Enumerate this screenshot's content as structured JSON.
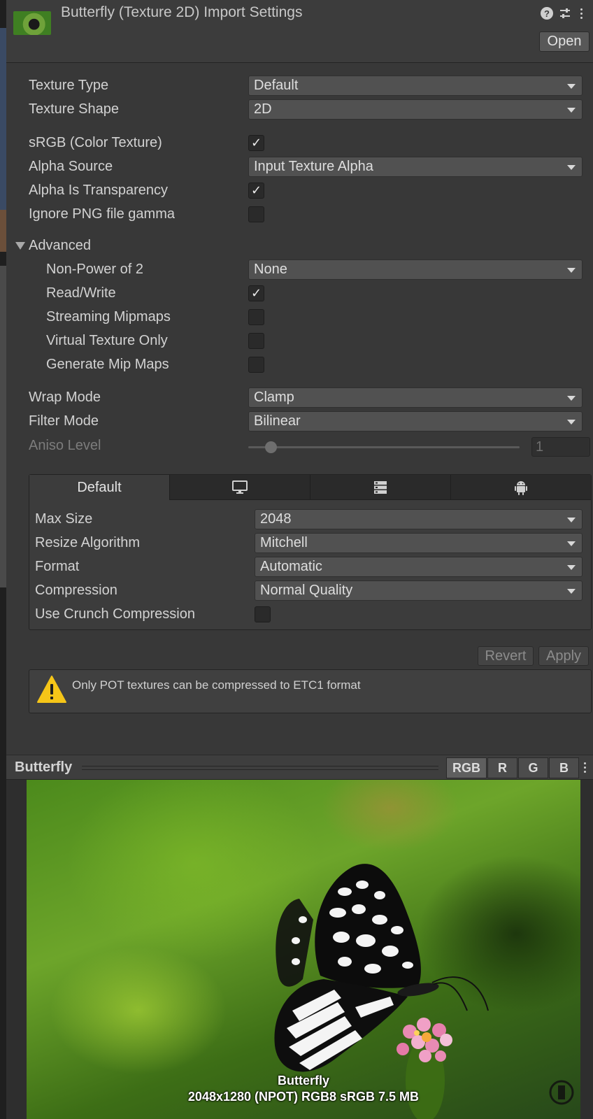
{
  "header": {
    "title": "Butterfly (Texture 2D) Import Settings",
    "help_icon": "help-icon",
    "presets_icon": "presets-icon",
    "open_label": "Open"
  },
  "settings": {
    "texture_type": {
      "label": "Texture Type",
      "value": "Default"
    },
    "texture_shape": {
      "label": "Texture Shape",
      "value": "2D"
    },
    "srgb": {
      "label": "sRGB (Color Texture)",
      "checked": true
    },
    "alpha_source": {
      "label": "Alpha Source",
      "value": "Input Texture Alpha"
    },
    "alpha_is_transparency": {
      "label": "Alpha Is Transparency",
      "checked": true
    },
    "ignore_png_gamma": {
      "label": "Ignore PNG file gamma",
      "checked": false
    }
  },
  "advanced": {
    "label": "Advanced",
    "expanded": true,
    "non_power_of_2": {
      "label": "Non-Power of 2",
      "value": "None"
    },
    "read_write": {
      "label": "Read/Write",
      "checked": true
    },
    "streaming_mipmaps": {
      "label": "Streaming Mipmaps",
      "checked": false
    },
    "virtual_texture_only": {
      "label": "Virtual Texture Only",
      "checked": false
    },
    "generate_mip_maps": {
      "label": "Generate Mip Maps",
      "checked": false
    }
  },
  "sampling": {
    "wrap_mode": {
      "label": "Wrap Mode",
      "value": "Clamp"
    },
    "filter_mode": {
      "label": "Filter Mode",
      "value": "Bilinear"
    },
    "aniso_level": {
      "label": "Aniso Level",
      "value": "1",
      "disabled": true
    }
  },
  "platform": {
    "tabs": [
      {
        "label": "Default",
        "icon": null,
        "active": true
      },
      {
        "label": "",
        "icon": "monitor-icon",
        "active": false
      },
      {
        "label": "",
        "icon": "server-icon",
        "active": false
      },
      {
        "label": "",
        "icon": "android-icon",
        "active": false
      }
    ],
    "max_size": {
      "label": "Max Size",
      "value": "2048"
    },
    "resize_algorithm": {
      "label": "Resize Algorithm",
      "value": "Mitchell"
    },
    "format": {
      "label": "Format",
      "value": "Automatic"
    },
    "compression": {
      "label": "Compression",
      "value": "Normal Quality"
    },
    "use_crunch": {
      "label": "Use Crunch Compression",
      "checked": false
    }
  },
  "actions": {
    "revert_label": "Revert",
    "apply_label": "Apply"
  },
  "warning": {
    "icon": "warning-icon",
    "text": "Only POT textures can be compressed to ETC1 format"
  },
  "preview": {
    "title": "Butterfly",
    "channels": [
      "RGB",
      "R",
      "G",
      "B"
    ],
    "active_channel": "RGB",
    "caption_name": "Butterfly",
    "caption_info": "2048x1280 (NPOT)  RGB8 sRGB   7.5 MB"
  },
  "colors": {
    "background": "#383838",
    "field": "#515151",
    "warning": "#f5c518"
  }
}
